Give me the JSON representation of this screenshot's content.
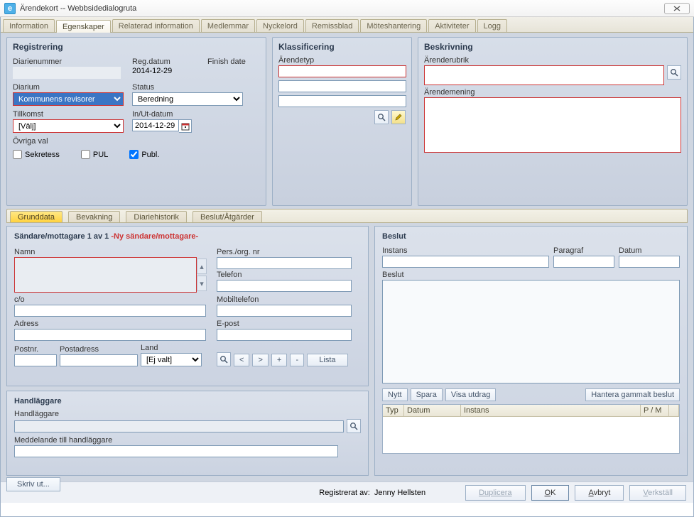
{
  "window": {
    "title": "Ärendekort -- Webbsidedialogruta",
    "icon_letter": "e"
  },
  "tabs": [
    "Information",
    "Egenskaper",
    "Relaterad information",
    "Medlemmar",
    "Nyckelord",
    "Remissblad",
    "Möteshantering",
    "Aktiviteter",
    "Logg"
  ],
  "active_tab": 1,
  "registrering": {
    "title": "Registrering",
    "diarienummer_lbl": "Diarienummer",
    "diarienummer": "",
    "regdatum_lbl": "Reg.datum",
    "regdatum": "2014-12-29",
    "finishdate_lbl": "Finish date",
    "finishdate": "",
    "diarium_lbl": "Diarium",
    "diarium": "Kommunens revisorer",
    "status_lbl": "Status",
    "status": "Beredning",
    "tillkomst_lbl": "Tillkomst",
    "tillkomst": "[Välj]",
    "inut_lbl": "In/Ut-datum",
    "inut": "2014-12-29",
    "ovriga_lbl": "Övriga val",
    "sekretess": "Sekretess",
    "pul": "PUL",
    "publ": "Publ.",
    "publ_checked": true
  },
  "klass": {
    "title": "Klassificering",
    "arend_lbl": "Ärendetyp"
  },
  "beskr": {
    "title": "Beskrivning",
    "rubrik_lbl": "Ärenderubrik",
    "mening_lbl": "Ärendemening"
  },
  "subtabs": [
    "Grunddata",
    "Bevakning",
    "Diariehistorik",
    "Beslut/Åtgärder"
  ],
  "active_subtab": 0,
  "sandare": {
    "hdr_a": "Sändare/mottagare 1 av 1 ",
    "hdr_b": "-Ny sändare/mottagare-",
    "namn": "Namn",
    "pers": "Pers./org. nr",
    "telefon": "Telefon",
    "co": "c/o",
    "mobil": "Mobiltelefon",
    "adress": "Adress",
    "epost": "E-post",
    "postnr": "Postnr.",
    "postadress": "Postadress",
    "land_lbl": "Land",
    "land": "[Ej valt]",
    "btns": {
      "search": "🔍",
      "prev": "<",
      "next": ">",
      "plus": "+",
      "minus": "-",
      "lista": "Lista"
    }
  },
  "handl": {
    "title": "Handläggare",
    "lbl": "Handläggare",
    "medd": "Meddelande till handläggare"
  },
  "beslut": {
    "title": "Beslut",
    "instans": "Instans",
    "paragraf": "Paragraf",
    "datum": "Datum",
    "beslut_lbl": "Beslut",
    "nytt": "Nytt",
    "spara": "Spara",
    "visa": "Visa utdrag",
    "hantera": "Hantera gammalt beslut",
    "th_typ": "Typ",
    "th_datum": "Datum",
    "th_instans": "Instans",
    "th_pm": "P / M"
  },
  "skriv": "Skriv ut...",
  "footer": {
    "regav_lbl": "Registrerat av:",
    "regav": "Jenny Hellsten",
    "duplicera": "Duplicera",
    "ok": "OK",
    "ok_u": "O",
    "avbryt": "Avbryt",
    "avbryt_u": "A",
    "verkstall": "Verkställ",
    "verkstall_u": "V"
  }
}
